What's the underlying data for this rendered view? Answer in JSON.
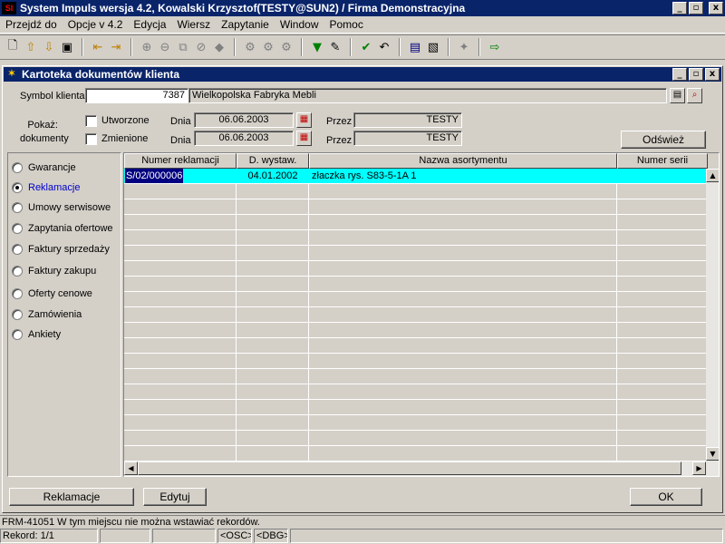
{
  "app": {
    "title": "System Impuls wersja 4.2, Kowalski Krzysztof(TESTY@SUN2) / Firma Demonstracyjna",
    "title_buttons": [
      "_",
      "▫",
      "x"
    ]
  },
  "menu": [
    "Przejdź do",
    "Opcje v 4.2",
    "Edycja",
    "Wiersz",
    "Zapytanie",
    "Window",
    "Pomoc"
  ],
  "toolbar": {
    "icons": [
      "new-document-icon",
      "arrow-up-icon",
      "arrow-down-icon",
      "save-icon",
      "first-record-icon",
      "last-record-icon",
      "insert-record-icon",
      "delete-record-icon",
      "duplicate-record-icon",
      "clear-record-icon",
      "eraser-icon",
      "query-icon",
      "execute-query-icon",
      "count-query-icon",
      "filter-icon",
      "clear-filter-icon",
      "commit-icon",
      "rollback-icon",
      "print-icon",
      "print-preview-icon",
      "help-icon",
      "exit-icon"
    ]
  },
  "window": {
    "title": "Kartoteka dokumentów klienta",
    "buttons": [
      "_",
      "▫",
      "x"
    ]
  },
  "client": {
    "label": "Symbol klienta",
    "code": "7387",
    "name": "Wielkopolska Fabryka Mebli"
  },
  "filter": {
    "show_label_1": "Pokaż:",
    "show_label_2": "dokumenty",
    "created_label": "Utworzone",
    "modified_label": "Zmienione",
    "created_checked": false,
    "modified_checked": false,
    "day_label": "Dnia",
    "created_date": "06.06.2003",
    "modified_date": "06.06.2003",
    "by_label": "Przez",
    "created_by": "TESTY",
    "modified_by": "TESTY",
    "refresh_label": "Odśwież"
  },
  "doc_types": [
    {
      "label": "Gwarancje",
      "selected": false
    },
    {
      "label": "Reklamacje",
      "selected": true
    },
    {
      "label": "Umowy serwisowe",
      "selected": false
    },
    {
      "label": "Zapytania ofertowe",
      "selected": false
    },
    {
      "label": "Faktury sprzedaży",
      "selected": false
    },
    {
      "label": "Faktury zakupu",
      "selected": false
    },
    {
      "label": "Oferty cenowe",
      "selected": false
    },
    {
      "label": "Zamówienia",
      "selected": false
    },
    {
      "label": "Ankiety",
      "selected": false
    }
  ],
  "table": {
    "columns": [
      "Numer reklamacji",
      "D. wystaw.",
      "Nazwa asortymentu",
      "Numer serii"
    ],
    "rows": [
      {
        "number": "S/02/000006",
        "date": "04.01.2002",
        "item": "złaczka  rys. S83-5-1A 1",
        "serial": ""
      }
    ]
  },
  "buttons": {
    "reklamacje": "Reklamacje",
    "edit": "Edytuj",
    "ok": "OK"
  },
  "status": {
    "message": "FRM-41051 W tym miejscu nie można wstawiać rekordów.",
    "record": "Rekord: 1/1",
    "osc": "<OSC>",
    "dbg": "<DBG>"
  }
}
